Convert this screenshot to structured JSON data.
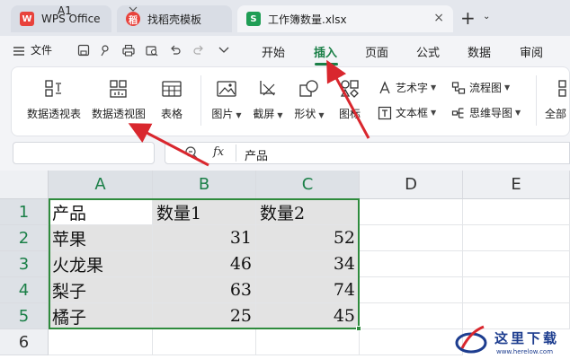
{
  "tabs": [
    {
      "label": "WPS Office",
      "logo": "W"
    },
    {
      "label": "找稻壳模板",
      "logo": "稻"
    },
    {
      "label": "工作簿数量.xlsx",
      "logo": "S"
    }
  ],
  "tab_close": "×",
  "tab_add": "+",
  "tab_menu": "⌄",
  "file_menu": "文件",
  "menu": [
    "开始",
    "插入",
    "页面",
    "公式",
    "数据",
    "审阅"
  ],
  "ribbon": {
    "pivot_table": "数据透视表",
    "pivot_chart": "数据透视图",
    "table": "表格",
    "picture": "图片",
    "screenshot": "截屏",
    "shape": "形状",
    "icon": "图标",
    "wordart": "艺术字",
    "textbox": "文本框",
    "flowchart": "流程图",
    "mindmap": "思维导图",
    "all": "全部"
  },
  "namebox": "A1",
  "formula_fx": "fx",
  "formula_value": "产品",
  "columns": [
    "A",
    "B",
    "C",
    "D",
    "E"
  ],
  "rows": [
    "1",
    "2",
    "3",
    "4",
    "5",
    "6"
  ],
  "table": {
    "header": [
      "产品",
      "数量1",
      "数量2"
    ],
    "data": [
      [
        "苹果",
        "31",
        "52"
      ],
      [
        "火龙果",
        "46",
        "34"
      ],
      [
        "梨子",
        "63",
        "74"
      ],
      [
        "橘子",
        "25",
        "45"
      ]
    ]
  },
  "watermark": {
    "title": "这里下载",
    "url": "www.herelow.com"
  },
  "colors": {
    "accent": "#1a7f47",
    "selection": "#2e8b3d",
    "arrow": "#d9272e"
  }
}
